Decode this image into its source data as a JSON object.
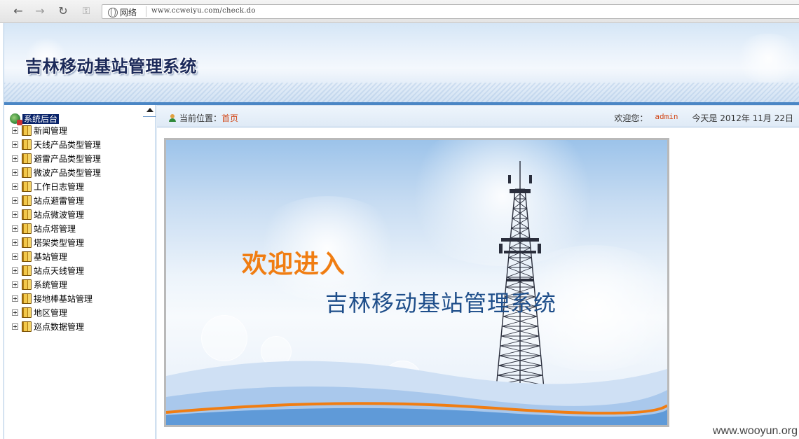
{
  "browser": {
    "back_icon": "arrow-left-icon",
    "forward_icon": "arrow-right-icon",
    "reload_icon": "reload-icon",
    "key_icon": "key-icon",
    "network_label": "网络",
    "url": "www.ccweiyu.com/check.do"
  },
  "header": {
    "title": "吉林移动基站管理系统"
  },
  "sidebar": {
    "root_label": "系统后台",
    "items": [
      {
        "label": "新闻管理"
      },
      {
        "label": "天线产品类型管理"
      },
      {
        "label": "避雷产品类型管理"
      },
      {
        "label": "微波产品类型管理"
      },
      {
        "label": "工作日志管理"
      },
      {
        "label": "站点避雷管理"
      },
      {
        "label": "站点微波管理"
      },
      {
        "label": "站点塔管理"
      },
      {
        "label": "塔架类型管理"
      },
      {
        "label": "基站管理"
      },
      {
        "label": "站点天线管理"
      },
      {
        "label": "系统管理"
      },
      {
        "label": "接地棒基站管理"
      },
      {
        "label": "地区管理"
      },
      {
        "label": "巡点数据管理"
      }
    ]
  },
  "breadcrumb": {
    "prefix": "当前位置：",
    "current": "首页"
  },
  "status": {
    "welcome_label": "欢迎您：",
    "username": "admin",
    "date_text": "今天是 2012年 11月 22日"
  },
  "banner": {
    "heading": "欢迎进入",
    "system_name": "吉林移动基站管理系统"
  },
  "watermark": "www.wooyun.org",
  "colors": {
    "accent_orange": "#f07d12",
    "link_red": "#d2491a",
    "title_navy": "#1c2a5a",
    "system_blue": "#1e4e8a"
  }
}
